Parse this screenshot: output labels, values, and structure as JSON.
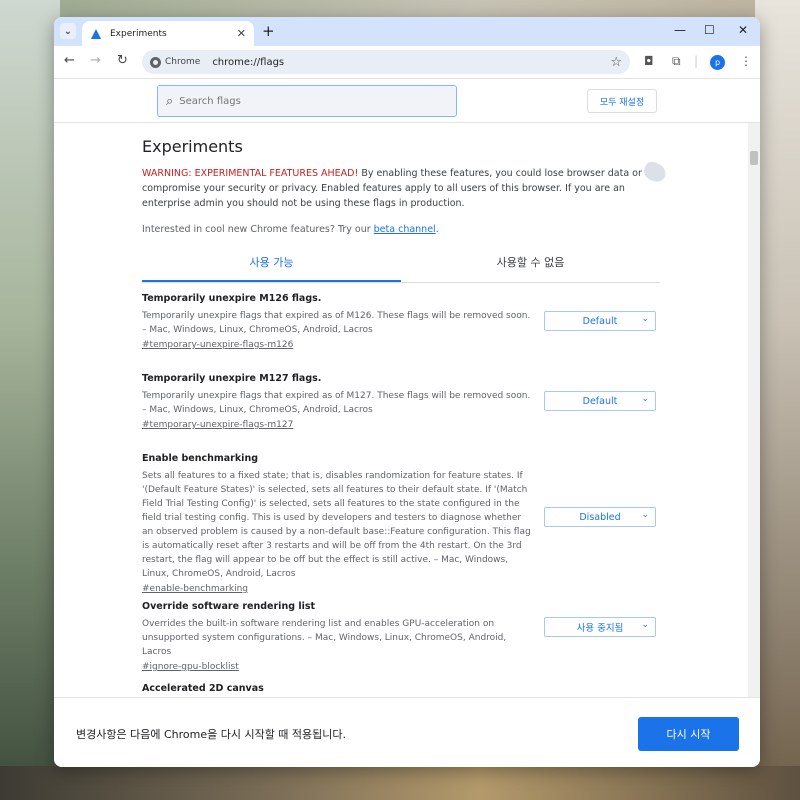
{
  "browser": {
    "tab_title": "Experiments",
    "tab_close": "✕",
    "new_tab": "+",
    "controls": {
      "minimize": "—",
      "maximize": "☐",
      "close": "✕"
    },
    "nav": {
      "back": "←",
      "forward": "→",
      "reload": "↻"
    },
    "omnibox": {
      "chip_label": "Chrome",
      "url": "chrome://flags",
      "star": "☆"
    },
    "profile_initial": "p"
  },
  "flags_page": {
    "search_placeholder": "Search flags",
    "reset_all_label": "모두 재설정",
    "title": "Experiments",
    "warning_prefix": "WARNING: EXPERIMENTAL FEATURES AHEAD!",
    "warning_text": " By enabling these features, you could lose browser data or compromise your security or privacy. Enabled features apply to all users of this browser. If you are an enterprise admin you should not be using these flags in production.",
    "interest_text": "Interested in cool new Chrome features? Try our ",
    "interest_link": "beta channel",
    "interest_suffix": ".",
    "tabs": [
      {
        "label": "사용 가능",
        "active": true
      },
      {
        "label": "사용할 수 없음",
        "active": false
      }
    ],
    "flags": [
      {
        "name": "Temporarily unexpire M126 flags.",
        "description": "Temporarily unexpire flags that expired as of M126. These flags will be removed soon. – Mac, Windows, Linux, ChromeOS, Android, Lacros",
        "link": "#temporary-unexpire-flags-m126",
        "value": "Default"
      },
      {
        "name": "Temporarily unexpire M127 flags.",
        "description": "Temporarily unexpire flags that expired as of M127. These flags will be removed soon. – Mac, Windows, Linux, ChromeOS, Android, Lacros",
        "link": "#temporary-unexpire-flags-m127",
        "value": "Default"
      },
      {
        "name": "Enable benchmarking",
        "description": "Sets all features to a fixed state; that is, disables randomization for feature states. If '(Default Feature States)' is selected, sets all features to their default state. If '(Match Field Trial Testing Config)' is selected, sets all features to the state configured in the field trial testing config. This is used by developers and testers to diagnose whether an observed problem is caused by a non-default base::Feature configuration. This flag is automatically reset after 3 restarts and will be off from the 4th restart. On the 3rd restart, the flag will appear to be off but the effect is still active. – Mac, Windows, Linux, ChromeOS, Android, Lacros",
        "link": "#enable-benchmarking",
        "value": "Disabled"
      },
      {
        "name": "Override software rendering list",
        "description": "Overrides the built-in software rendering list and enables GPU-acceleration on unsupported system configurations. – Mac, Windows, Linux, ChromeOS, Android, Lacros",
        "link": "#ignore-gpu-blocklist",
        "value": "사용 중지됨"
      },
      {
        "name": "Accelerated 2D canvas",
        "description": "",
        "link": "",
        "value": ""
      }
    ]
  },
  "bottom_bar": {
    "message": "변경사항은 다음에 Chrome을 다시 시작할 때 적용됩니다.",
    "restart_label": "다시 시작"
  }
}
